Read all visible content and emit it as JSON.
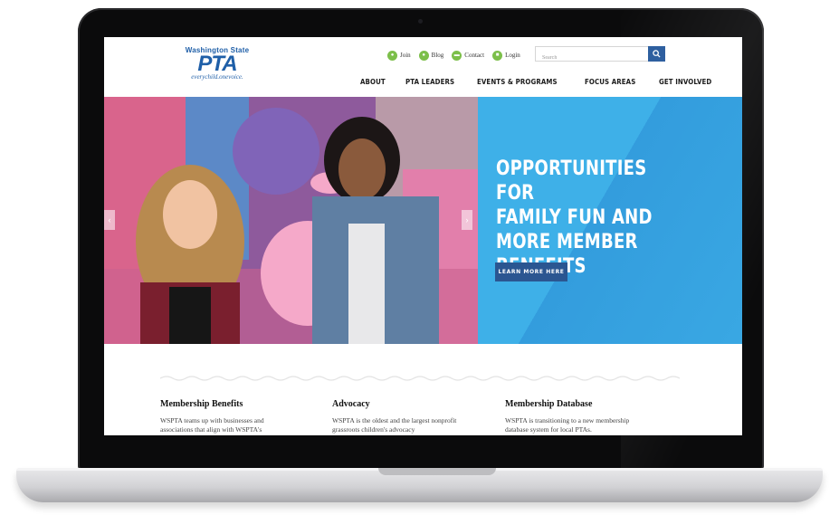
{
  "logo": {
    "top": "Washington State",
    "main": "PTA",
    "tagline": "everychild.onevoice."
  },
  "utility": {
    "items": [
      {
        "label": "Join",
        "icon": "person-icon"
      },
      {
        "label": "Blog",
        "icon": "chat-bubble-icon"
      },
      {
        "label": "Contact",
        "icon": "message-icon"
      },
      {
        "label": "Login",
        "icon": "lock-icon"
      }
    ],
    "search_placeholder": "Search"
  },
  "nav": {
    "items": [
      "ABOUT",
      "PTA LEADERS",
      "EVENTS & PROGRAMS",
      "FOCUS AREAS",
      "GET INVOLVED"
    ]
  },
  "hero": {
    "title": "OPPORTUNITIES FOR\nFAMILY FUN AND\nMORE MEMBER\nBENEFITS",
    "button": "LEARN MORE HERE",
    "accent_color": "#3eb0e8"
  },
  "columns": [
    {
      "title": "Membership Benefits",
      "text": "WSPTA teams up with businesses and associations that align with WSPTA's"
    },
    {
      "title": "Advocacy",
      "text": "WSPTA is the oldest and the largest nonprofit grassroots children's advocacy"
    },
    {
      "title": "Membership Database",
      "text": "WSPTA is transitioning to a new membership database system for local PTAs."
    }
  ],
  "colors": {
    "brand": "#1f5fa8",
    "icon_green": "#7cbf4a",
    "button_blue": "#2b5691"
  }
}
